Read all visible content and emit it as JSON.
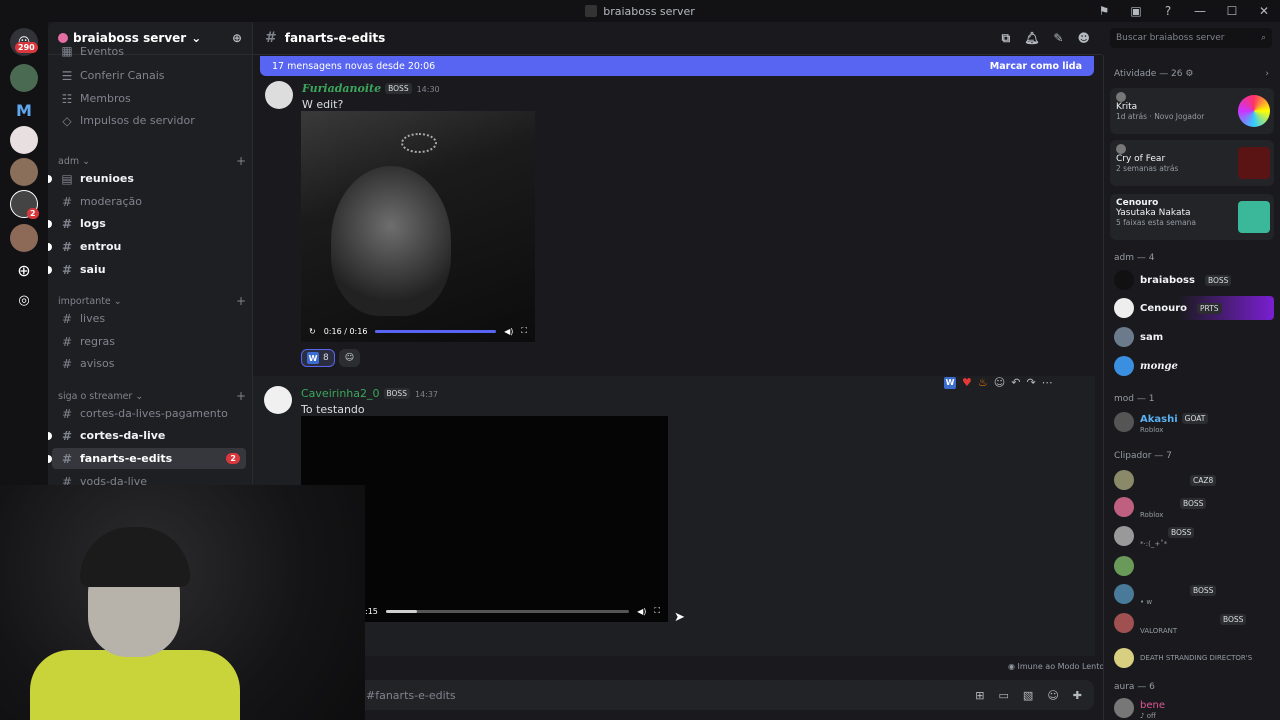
{
  "window": {
    "title": "braiaboss server"
  },
  "guilds": {
    "home_badge": "290",
    "item_badge": "2"
  },
  "server": {
    "name": "braiaboss server"
  },
  "channels_top": [
    "Eventos",
    "Conferir Canais",
    "Membros",
    "Impulsos de servidor"
  ],
  "categories": {
    "adm": "adm",
    "importante": "importante",
    "streamer": "siga o streamer"
  },
  "channels_adm": [
    "reunioes",
    "moderação",
    "logs",
    "entrou",
    "saiu"
  ],
  "channels_importante": [
    "lives",
    "regras",
    "avisos"
  ],
  "channels_streamer": [
    "cortes-da-lives-pagamento",
    "cortes-da-live",
    "fanarts-e-edits",
    "vods-da-live"
  ],
  "selected_channel_count": "2",
  "channel_header": {
    "name": "fanarts-e-edits"
  },
  "new_messages": {
    "text": "17 mensagens novas desde 20:06",
    "mark": "Marcar como lida"
  },
  "messages": [
    {
      "user": "Furiadanoite",
      "tag": "BOSS",
      "time": "14:30",
      "text": "W edit?",
      "video_time": "0:16 / 0:16",
      "reaction_count": "8"
    },
    {
      "user": "Caveirinha2_0",
      "tag": "BOSS",
      "time": "14:37",
      "text": "To testando",
      "video_time": ":15"
    }
  ],
  "input": {
    "placeholder": "#fanarts-e-edits",
    "slow_mode": "Imune ao Modo Lento"
  },
  "search": {
    "placeholder": "Buscar braiaboss server"
  },
  "activity": {
    "header": "Atividade — 26",
    "cards": [
      {
        "name": "Krita",
        "sub": "1d atrás  ·  Novo Jogador"
      },
      {
        "name": "Cry of Fear",
        "sub": "2 semanas atrás"
      },
      {
        "name": "Cenouro",
        "line2": "Yasutaka Nakata",
        "sub": "5 faixas esta semana"
      }
    ]
  },
  "member_sections": {
    "adm": "adm — 4",
    "mod": "mod — 1",
    "clipador": "Clipador — 7",
    "aura": "aura — 6"
  },
  "members_adm": [
    {
      "name": "braiaboss",
      "tag": "BOSS"
    },
    {
      "name": "Cenouro",
      "tag": "PRTS"
    },
    {
      "name": "sam",
      "tag": ""
    },
    {
      "name": "monge",
      "tag": ""
    }
  ],
  "members_mod": [
    {
      "name": "Akashi",
      "tag": "GOAT",
      "sub": "Roblox"
    }
  ],
  "members_clip": [
    {
      "tag": "CAZ8",
      "sub": ""
    },
    {
      "tag": "BOSS",
      "sub": "Roblox"
    },
    {
      "tag": "BOSS",
      "sub": "*·:(_+˚*"
    },
    {
      "tag": "",
      "sub": ""
    },
    {
      "tag": "BOSS",
      "sub": "• w"
    },
    {
      "tag": "BOSS",
      "sub": "VALORANT"
    },
    {
      "tag": "",
      "sub": "DEATH STRANDING DIRECTOR'S"
    }
  ],
  "members_aura": [
    {
      "name": "bene",
      "sub": "♪ off"
    }
  ]
}
